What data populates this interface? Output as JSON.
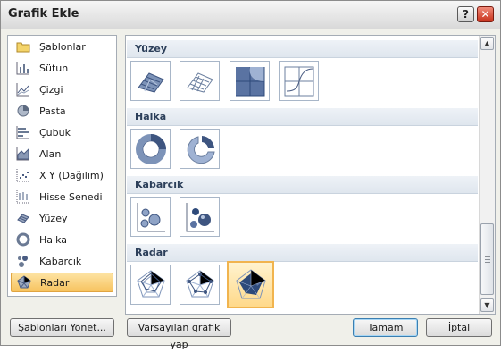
{
  "window": {
    "title": "Grafik Ekle"
  },
  "titlebar": {
    "help_label": "?",
    "close_label": "✕"
  },
  "categories": [
    {
      "label": "Şablonlar",
      "icon": "folder-icon"
    },
    {
      "label": "Sütun",
      "icon": "column-chart-icon"
    },
    {
      "label": "Çizgi",
      "icon": "line-chart-icon"
    },
    {
      "label": "Pasta",
      "icon": "pie-chart-icon"
    },
    {
      "label": "Çubuk",
      "icon": "bar-chart-icon"
    },
    {
      "label": "Alan",
      "icon": "area-chart-icon"
    },
    {
      "label": "X Y (Dağılım)",
      "icon": "scatter-chart-icon"
    },
    {
      "label": "Hisse Senedi",
      "icon": "stock-chart-icon"
    },
    {
      "label": "Yüzey",
      "icon": "surface-chart-icon"
    },
    {
      "label": "Halka",
      "icon": "doughnut-chart-icon"
    },
    {
      "label": "Kabarcık",
      "icon": "bubble-chart-icon"
    },
    {
      "label": "Radar",
      "icon": "radar-chart-icon"
    }
  ],
  "selected_category": "Radar",
  "sections": [
    {
      "title": "Yüzey",
      "thumbs": [
        "3d-surface-icon",
        "wireframe-3d-surface-icon",
        "contour-icon",
        "wireframe-contour-icon"
      ]
    },
    {
      "title": "Halka",
      "thumbs": [
        "doughnut-icon",
        "exploded-doughnut-icon"
      ]
    },
    {
      "title": "Kabarcık",
      "thumbs": [
        "bubble-icon",
        "3d-bubble-icon"
      ]
    },
    {
      "title": "Radar",
      "thumbs": [
        "radar-icon",
        "radar-markers-icon",
        "filled-radar-icon"
      ]
    }
  ],
  "buttons": {
    "manage_templates": "Şablonları Yönet...",
    "set_default": "Varsayılan grafik yap",
    "ok": "Tamam",
    "cancel": "İptal"
  }
}
